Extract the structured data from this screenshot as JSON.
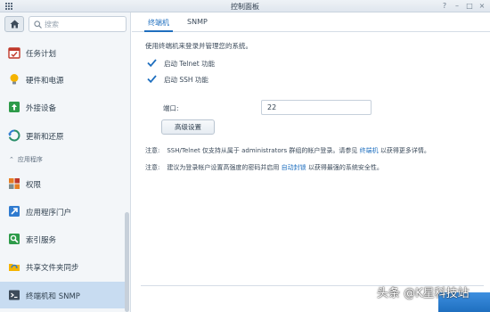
{
  "window": {
    "title": "控制面板"
  },
  "sidebar": {
    "search_placeholder": "搜索",
    "items_top": [
      {
        "label": "任务计划",
        "icon": "task-schedule-icon"
      },
      {
        "label": "硬件和电源",
        "icon": "lightbulb-icon"
      },
      {
        "label": "外接设备",
        "icon": "external-device-icon"
      },
      {
        "label": "更新和还原",
        "icon": "update-restore-icon"
      }
    ],
    "section_label": "应用程序",
    "items_apps": [
      {
        "label": "权限",
        "icon": "privileges-icon"
      },
      {
        "label": "应用程序门户",
        "icon": "app-portal-icon"
      },
      {
        "label": "索引服务",
        "icon": "indexing-icon"
      },
      {
        "label": "共享文件夹同步",
        "icon": "shared-folder-sync-icon"
      },
      {
        "label": "终端机和 SNMP",
        "icon": "terminal-icon",
        "active": true
      }
    ]
  },
  "tabs": [
    {
      "label": "终端机",
      "active": true
    },
    {
      "label": "SNMP",
      "active": false
    }
  ],
  "terminal": {
    "description": "使用终端机来登录并管理您的系统。",
    "telnet_label": "启动 Telnet 功能",
    "telnet_enabled": true,
    "ssh_label": "启动 SSH 功能",
    "ssh_enabled": true,
    "port_label": "端口:",
    "port_value": "22",
    "advanced_button": "高级设置"
  },
  "notes": [
    {
      "label": "注意:",
      "text_before": "SSH/Telnet 仅支持从属于 administrators 群组的帐户登录。请参见",
      "link": "终端机",
      "text_after": "以获得更多详情。"
    },
    {
      "label": "注意:",
      "text_before": "建议为登录帐户设置高强度的密码并启用",
      "link": "自动封锁",
      "text_after": "以获得最强的系统安全性。"
    }
  ],
  "watermark": "头条 @K星科技站",
  "colors": {
    "accent": "#1f6fbf",
    "sidebar_bg": "#f3f6f9",
    "active_item_bg": "#c8dcf1"
  }
}
